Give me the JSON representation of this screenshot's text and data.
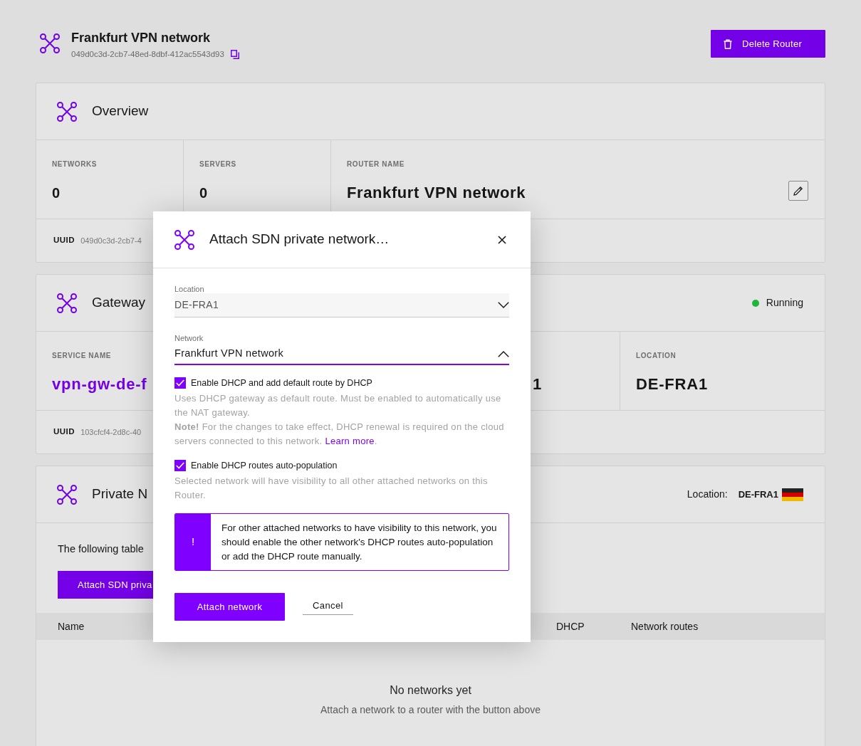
{
  "header": {
    "title": "Frankfurt VPN network",
    "uuid": "049d0c3d-2cb7-48ed-8dbf-412ac5543d93",
    "delete_button": "Delete Router"
  },
  "overview": {
    "title": "Overview",
    "stats": [
      {
        "kind": "text",
        "label": "NETWORKS",
        "value": "0"
      },
      {
        "kind": "text",
        "label": "SERVERS",
        "value": "0"
      },
      {
        "kind": "editable",
        "label": "ROUTER NAME",
        "value": "Frankfurt VPN network"
      }
    ],
    "uuid_label": "UUID",
    "uuid": "049d0c3d-2cb7-4"
  },
  "gateway": {
    "title": "Gateway",
    "status": {
      "label": "Running",
      "color": "#1fb53a"
    },
    "stats": [
      {
        "kind": "link",
        "label": "SERVICE NAME",
        "value": "vpn-gw-de-f"
      },
      {
        "kind": "partial",
        "value": "1"
      },
      {
        "kind": "text",
        "label": "LOCATION",
        "value": "DE-FRA1"
      }
    ],
    "uuid_label": "UUID",
    "uuid": "103cfcf4-2d8c-40"
  },
  "private_networks": {
    "title": "Private N",
    "location_label": "Location:",
    "location": "DE-FRA1",
    "intro": "The following table",
    "attach_button": "Attach SDN priva",
    "table": {
      "columns": [
        "Name",
        "DHCP",
        "Network routes"
      ]
    },
    "empty": {
      "title": "No networks yet",
      "text": "Attach a network to a router with the button above"
    }
  },
  "modal": {
    "title": "Attach SDN private network…",
    "fields": [
      {
        "label": "Location",
        "value": "DE-FRA1",
        "disabled": true,
        "expanded": false
      },
      {
        "label": "Network",
        "value": "Frankfurt VPN network",
        "disabled": false,
        "expanded": true
      }
    ],
    "options": [
      {
        "label": "Enable DHCP and add default route by DHCP",
        "checked": true,
        "help": "Uses DHCP gateway as default route. Must be enabled to automatically use the NAT gateway.",
        "note": {
          "text": "**Note!** For the changes to take effect, DHCP renewal is required on the cloud servers connected to this network.",
          "link": "Learn more",
          "after_link": "."
        }
      },
      {
        "label": "Enable DHCP routes auto-population",
        "checked": true,
        "help": "Selected network will have visibility to all other attached networks on this Router."
      }
    ],
    "alert": {
      "icon": "!",
      "text": "For other attached networks to have visibility to this network, you should enable the other network's DHCP routes auto-population or add the DHCP route manually."
    },
    "buttons": [
      {
        "kind": "primary",
        "label": "Attach network"
      },
      {
        "kind": "link",
        "label": "Cancel"
      }
    ]
  }
}
